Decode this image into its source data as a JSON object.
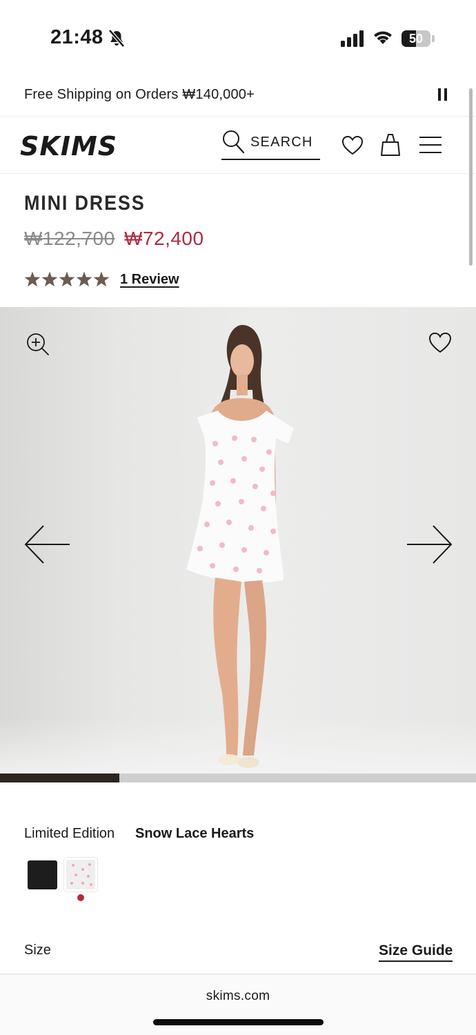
{
  "status_bar": {
    "time": "21:48",
    "battery_level": "50",
    "battery_fraction": 0.5
  },
  "promo": {
    "text": "Free Shipping on Orders ₩140,000+"
  },
  "header": {
    "logo_text": "SKIMS",
    "search_label": "SEARCH"
  },
  "product": {
    "title": "MINI DRESS",
    "price_original": "₩122,700",
    "price_sale": "₩72,400",
    "rating_stars": 5,
    "reviews_label": "1 Review",
    "colors": {
      "star": "#6b5d52",
      "sale": "#b1293f"
    }
  },
  "gallery": {
    "progress_fraction": 0.25
  },
  "options": {
    "color_label": "Limited Edition",
    "color_value": "Snow Lace Hearts",
    "swatches": [
      {
        "name": "Onyx",
        "color": "#1d1d1d",
        "selected": false
      },
      {
        "name": "Snow Lace Hearts",
        "color": "#efefef",
        "selected": true
      }
    ],
    "size_label": "Size",
    "size_guide_label": "Size Guide"
  },
  "browser": {
    "url": "skims.com"
  }
}
